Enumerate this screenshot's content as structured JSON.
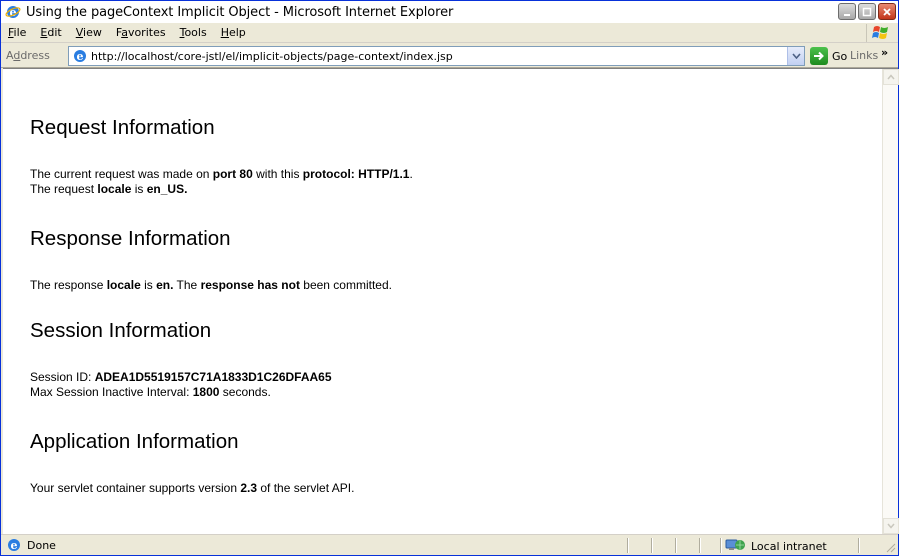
{
  "window": {
    "title": "Using the pageContext Implicit Object - Microsoft Internet Explorer"
  },
  "menu": {
    "items": [
      {
        "key": "F",
        "rest": "ile"
      },
      {
        "key": "E",
        "rest": "dit"
      },
      {
        "key": "V",
        "rest": "iew"
      },
      {
        "pre": "F",
        "key": "a",
        "rest": "vorites"
      },
      {
        "key": "T",
        "rest": "ools"
      },
      {
        "key": "H",
        "rest": "elp"
      }
    ]
  },
  "address": {
    "label_pre": "A",
    "label_key": "d",
    "label_rest": "dress",
    "url": "http://localhost/core-jstl/el/implicit-objects/page-context/index.jsp",
    "go_label": "Go",
    "links_label": "Links"
  },
  "page": {
    "request": {
      "heading": "Request Information",
      "l1_a": "The current request was made on ",
      "l1_b": "port 80",
      "l1_c": " with this ",
      "l1_d": "protocol: HTTP/1.1",
      "l1_e": ".",
      "l2_a": "The request ",
      "l2_b": "locale",
      "l2_c": " is ",
      "l2_d": "en_US."
    },
    "response": {
      "heading": "Response Information",
      "l1_a": "The response ",
      "l1_b": "locale",
      "l1_c": " is ",
      "l1_d": "en.",
      "l1_e": " The ",
      "l1_f": "response has not",
      "l1_g": " been committed."
    },
    "session": {
      "heading": "Session Information",
      "l1_a": "Session ID: ",
      "l1_b": "ADEA1D5519157C71A1833D1C26DFAA65",
      "l2_a": "Max Session Inactive Interval: ",
      "l2_b": "1800",
      "l2_c": " seconds."
    },
    "application": {
      "heading": "Application Information",
      "l1_a": "Your servlet container supports version ",
      "l1_b": "2.3",
      "l1_c": " of the servlet API."
    }
  },
  "status": {
    "text": "Done",
    "zone": "Local intranet"
  },
  "colors": {
    "titlebar": "#0058e6",
    "chrome": "#ece9d8",
    "go_green": "#1e8a1e"
  }
}
